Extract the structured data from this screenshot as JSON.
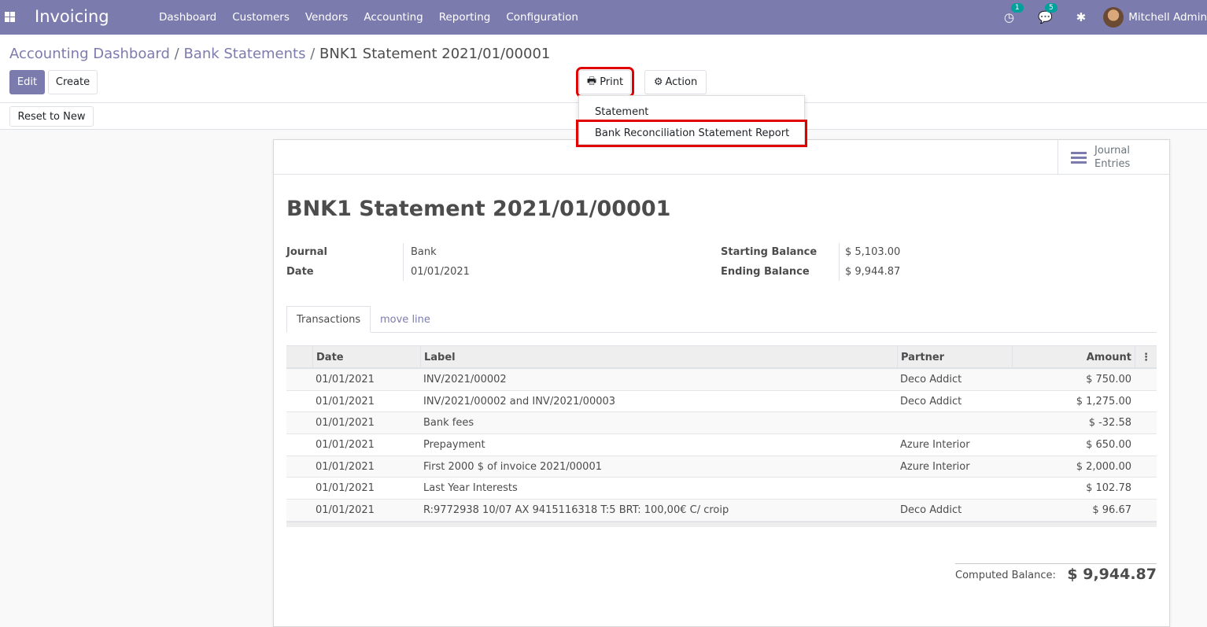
{
  "navbar": {
    "app_title": "Invoicing",
    "menu": [
      "Dashboard",
      "Customers",
      "Vendors",
      "Accounting",
      "Reporting",
      "Configuration"
    ],
    "activity_count": "1",
    "messages_count": "5",
    "user_name": "Mitchell Admin"
  },
  "breadcrumb": {
    "items": [
      "Accounting Dashboard",
      "Bank Statements"
    ],
    "separator": "/",
    "current": "BNK1 Statement 2021/01/00001"
  },
  "actions": {
    "edit": "Edit",
    "create": "Create",
    "print": "Print",
    "action": "Action",
    "reset": "Reset to New"
  },
  "print_menu": {
    "items": [
      "Statement",
      "Bank Reconciliation Statement Report"
    ]
  },
  "smart_button": {
    "line1": "Journal",
    "line2": "Entries"
  },
  "record": {
    "title": "BNK1 Statement 2021/01/00001",
    "journal_label": "Journal",
    "journal_value": "Bank",
    "date_label": "Date",
    "date_value": "01/01/2021",
    "starting_label": "Starting Balance",
    "starting_value": "$ 5,103.00",
    "ending_label": "Ending Balance",
    "ending_value": "$ 9,944.87"
  },
  "tabs": [
    "Transactions",
    "move line"
  ],
  "table": {
    "headers": [
      "Date",
      "Label",
      "Partner",
      "Amount"
    ],
    "options_icon": "⋮",
    "rows": [
      {
        "date": "01/01/2021",
        "label": "INV/2021/00002",
        "partner": "Deco Addict",
        "amount": "$ 750.00"
      },
      {
        "date": "01/01/2021",
        "label": "INV/2021/00002 and INV/2021/00003",
        "partner": "Deco Addict",
        "amount": "$ 1,275.00"
      },
      {
        "date": "01/01/2021",
        "label": "Bank fees",
        "partner": "",
        "amount": "$ -32.58"
      },
      {
        "date": "01/01/2021",
        "label": "Prepayment",
        "partner": "Azure Interior",
        "amount": "$ 650.00"
      },
      {
        "date": "01/01/2021",
        "label": "First 2000 $ of invoice 2021/00001",
        "partner": "Azure Interior",
        "amount": "$ 2,000.00"
      },
      {
        "date": "01/01/2021",
        "label": "Last Year Interests",
        "partner": "",
        "amount": "$ 102.78"
      },
      {
        "date": "01/01/2021",
        "label": "R:9772938 10/07 AX 9415116318 T:5 BRT: 100,00€ C/ croip",
        "partner": "Deco Addict",
        "amount": "$ 96.67"
      }
    ]
  },
  "computed_balance": {
    "label": "Computed Balance:",
    "value": "$ 9,944.87"
  },
  "colors": {
    "brand": "#7c7bad",
    "highlight": "#e00000",
    "badge": "#00a09d"
  }
}
